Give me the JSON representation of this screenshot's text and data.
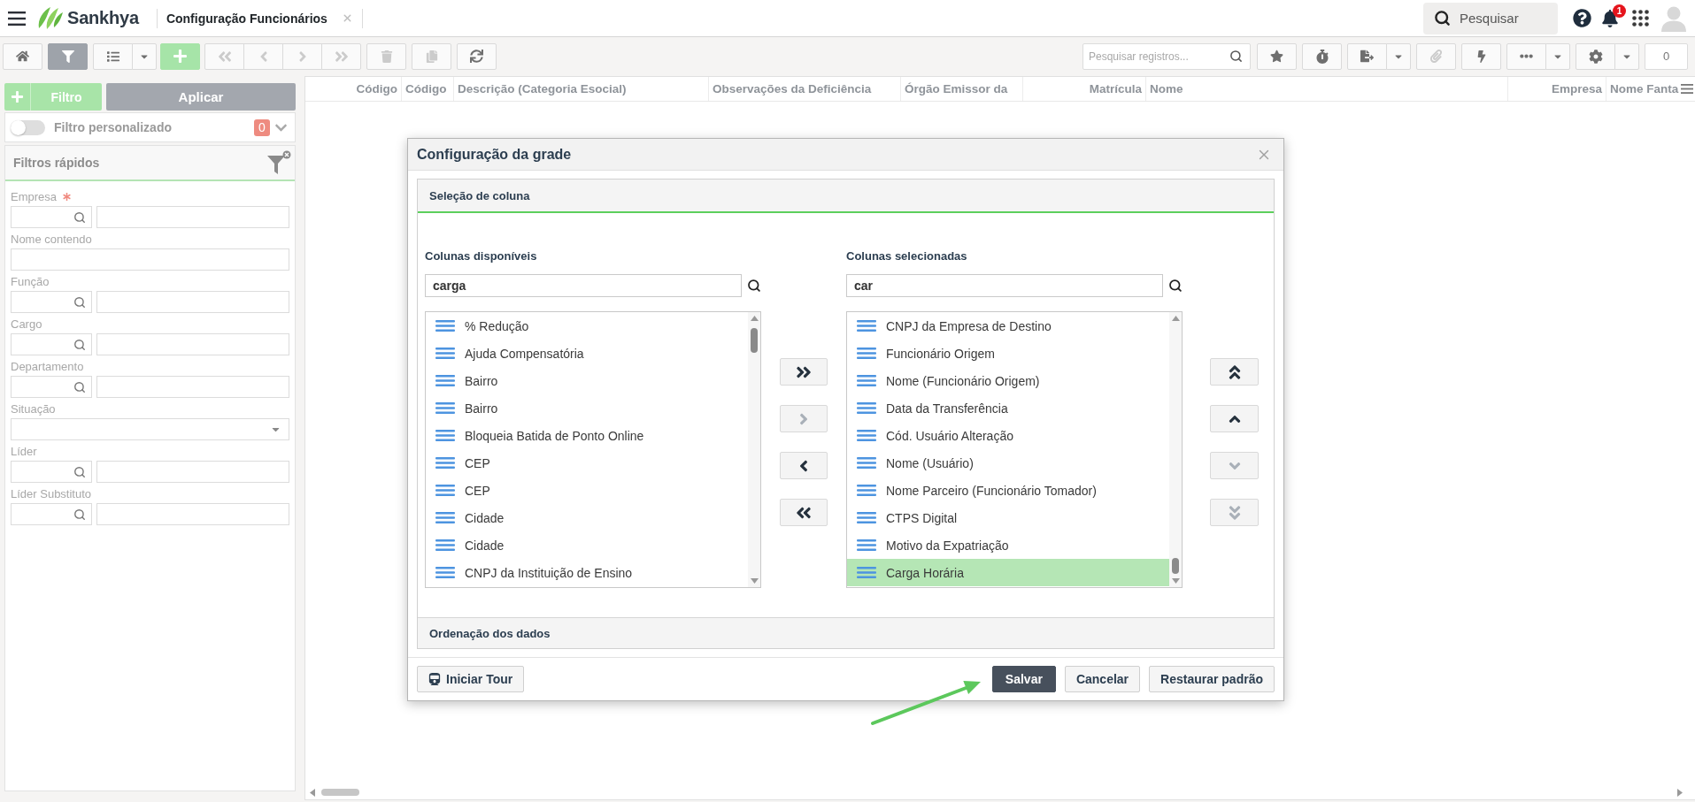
{
  "topbar": {
    "logo_text": "Sankhya",
    "tab_title": "Configuração Funcionários",
    "search": {
      "placeholder": "Pesquisar"
    },
    "notifications": "1"
  },
  "toolbar": {
    "left_buttons": [
      {
        "kind": "home",
        "active": false,
        "disabled": false
      },
      {
        "kind": "filter",
        "active": true,
        "disabled": false
      },
      {
        "kind": "list_menu",
        "active": false,
        "disabled": false
      },
      {
        "kind": "add",
        "active": false,
        "disabled": false
      },
      {
        "kind": "first",
        "active": false,
        "disabled": true
      },
      {
        "kind": "previous",
        "active": false,
        "disabled": true
      },
      {
        "kind": "next",
        "active": false,
        "disabled": true
      },
      {
        "kind": "last",
        "active": false,
        "disabled": true
      },
      {
        "kind": "delete",
        "active": false,
        "disabled": true
      },
      {
        "kind": "duplicate",
        "active": false,
        "disabled": true
      },
      {
        "kind": "refresh",
        "active": false,
        "disabled": false
      }
    ],
    "search": {
      "placeholder": "Pesquisar registros..."
    },
    "right_buttons": [
      {
        "kind": "favorite",
        "disabled": false
      },
      {
        "kind": "timer",
        "disabled": false
      },
      {
        "kind": "export_menu",
        "disabled": false
      },
      {
        "kind": "attach",
        "disabled": true
      },
      {
        "kind": "actions",
        "disabled": false
      },
      {
        "kind": "more_menu",
        "disabled": false
      },
      {
        "kind": "settings_menu",
        "disabled": false
      }
    ],
    "record_count": "0"
  },
  "sidebar": {
    "filter_button": "Filtro",
    "apply_button": "Aplicar",
    "custom_filter": {
      "label": "Filtro personalizado",
      "on": false,
      "count": "0"
    },
    "quick_filters": {
      "title": "Filtros rápidos",
      "fields": [
        {
          "label": "Empresa",
          "kind": "lookup",
          "required": true
        },
        {
          "label": "Nome contendo",
          "kind": "text",
          "required": false
        },
        {
          "label": "Função",
          "kind": "lookup",
          "required": false
        },
        {
          "label": "Cargo",
          "kind": "lookup",
          "required": false
        },
        {
          "label": "Departamento",
          "kind": "lookup",
          "required": false
        },
        {
          "label": "Situação",
          "kind": "select",
          "required": false
        },
        {
          "label": "Líder",
          "kind": "lookup",
          "required": false
        },
        {
          "label": "Líder Substituto",
          "kind": "lookup",
          "required": false
        }
      ]
    }
  },
  "grid": {
    "columns": [
      {
        "label": "Código"
      },
      {
        "label": "Código"
      },
      {
        "label": "Descrição (Categoria Esocial)"
      },
      {
        "label": "Observações da Deficiência"
      },
      {
        "label": "Órgão Emissor da"
      },
      {
        "label": "Matrícula"
      },
      {
        "label": "Nome"
      },
      {
        "label": "Empresa"
      },
      {
        "label": "Nome Fanta"
      }
    ]
  },
  "dialog": {
    "title": "Configuração da grade",
    "sections": [
      {
        "title": "Seleção de coluna",
        "expanded": true,
        "available": {
          "title": "Colunas disponíveis",
          "search": "carga",
          "items": [
            {
              "label": "% Redução",
              "selected": false
            },
            {
              "label": "Ajuda Compensatória",
              "selected": false
            },
            {
              "label": "Bairro",
              "selected": false
            },
            {
              "label": "Bairro",
              "selected": false
            },
            {
              "label": "Bloqueia Batida de Ponto Online",
              "selected": false
            },
            {
              "label": "CEP",
              "selected": false
            },
            {
              "label": "CEP",
              "selected": false
            },
            {
              "label": "Cidade",
              "selected": false
            },
            {
              "label": "Cidade",
              "selected": false
            },
            {
              "label": "CNPJ da Instituição de Ensino",
              "selected": false
            }
          ]
        },
        "transfer_buttons": [
          {
            "kind": "add_all",
            "disabled": false
          },
          {
            "kind": "add",
            "disabled": true
          },
          {
            "kind": "remove",
            "disabled": false
          },
          {
            "kind": "remove_all",
            "disabled": false
          }
        ],
        "chosen": {
          "title": "Colunas selecionadas",
          "search": "car",
          "items": [
            {
              "label": "CNPJ da Empresa de Destino",
              "selected": false
            },
            {
              "label": "Funcionário Origem",
              "selected": false
            },
            {
              "label": "Nome (Funcionário Origem)",
              "selected": false
            },
            {
              "label": "Data da Transferência",
              "selected": false
            },
            {
              "label": "Cód. Usuário Alteração",
              "selected": false
            },
            {
              "label": "Nome (Usuário)",
              "selected": false
            },
            {
              "label": "Nome Parceiro (Funcionário Tomador)",
              "selected": false
            },
            {
              "label": "CTPS Digital",
              "selected": false
            },
            {
              "label": "Motivo da Expatriação",
              "selected": false
            },
            {
              "label": "Carga Horária",
              "selected": true
            }
          ]
        },
        "order_buttons": [
          {
            "kind": "top",
            "disabled": false
          },
          {
            "kind": "up",
            "disabled": false
          },
          {
            "kind": "down",
            "disabled": true
          },
          {
            "kind": "bottom",
            "disabled": true
          }
        ]
      },
      {
        "title": "Ordenação dos dados",
        "expanded": false
      }
    ],
    "footer": {
      "buttons": [
        {
          "label": "Iniciar Tour",
          "kind": "tour"
        },
        {
          "label": "Salvar",
          "kind": "primary"
        },
        {
          "label": "Cancelar",
          "kind": "secondary"
        },
        {
          "label": "Restaurar padrão",
          "kind": "secondary"
        }
      ]
    }
  }
}
